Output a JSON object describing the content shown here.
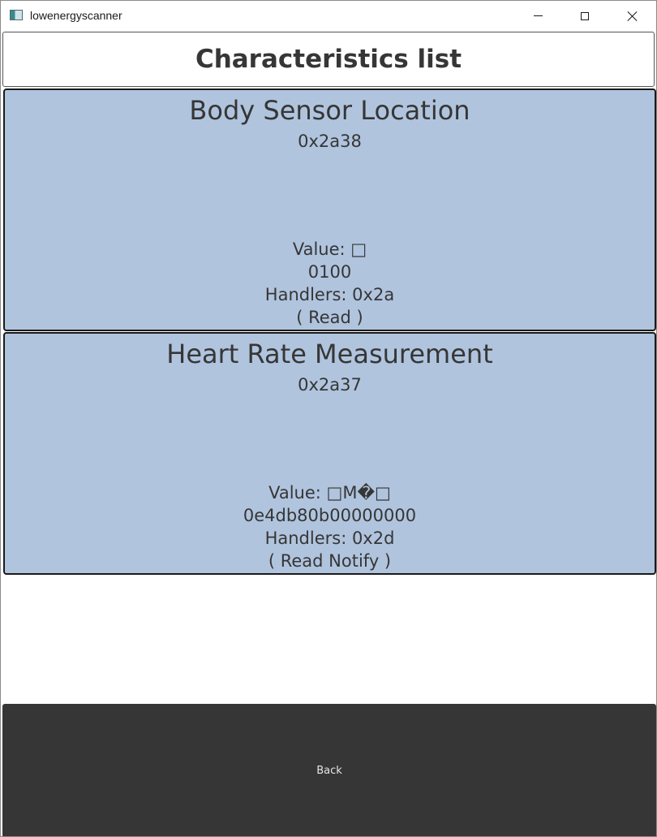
{
  "window": {
    "title": "lowenergyscanner",
    "icon": "app-window-icon",
    "controls": [
      "minimize-icon",
      "maximize-icon",
      "close-icon"
    ]
  },
  "header": {
    "title": "Characteristics list"
  },
  "characteristics": [
    {
      "name": "Body Sensor Location",
      "uuid": "0x2a38",
      "value_line": "Value: □",
      "hex_value": "0100",
      "handlers": "Handlers: 0x2a",
      "permissions": "(  Read )"
    },
    {
      "name": "Heart Rate Measurement",
      "uuid": "0x2a37",
      "value_line": "Value: □M�□",
      "hex_value": "0e4db80b00000000",
      "handlers": "Handlers: 0x2d",
      "permissions": "(  Read Notify )"
    }
  ],
  "footer": {
    "back_label": "Back"
  },
  "colors": {
    "card_background": "#b0c4de",
    "text": "#363636",
    "back_button": "#363636"
  }
}
